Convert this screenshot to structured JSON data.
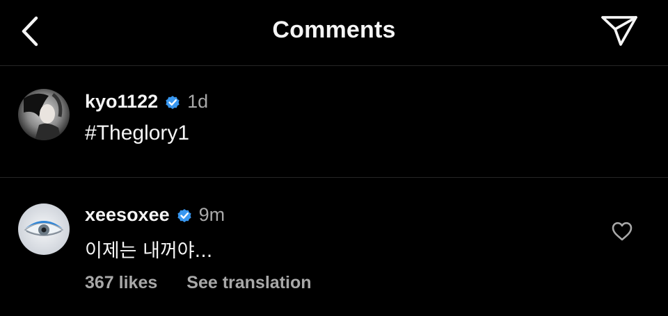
{
  "header": {
    "title": "Comments",
    "back_icon": "chevron-left-icon",
    "send_icon": "paper-plane-icon"
  },
  "caption": {
    "username": "kyo1122",
    "verified": true,
    "time": "1d",
    "text": "#Theglory1"
  },
  "comment": {
    "username": "xeesoxee",
    "verified": true,
    "time": "9m",
    "text": "이제는 내꺼야...",
    "likes": "367 likes",
    "translate_label": "See translation",
    "like_icon": "heart-outline-icon"
  },
  "colors": {
    "background": "#000000",
    "text": "#f5f5f5",
    "secondary_text": "#a8a8a8",
    "verified_badge": "#3897f0",
    "divider": "#262626"
  }
}
